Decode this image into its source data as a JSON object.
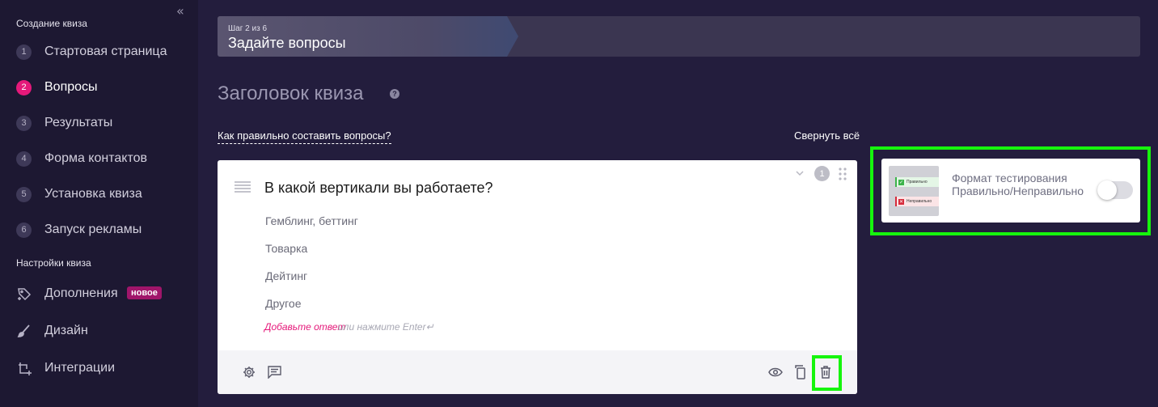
{
  "sidebar": {
    "collapse_glyph": "«",
    "section_create": "Создание квиза",
    "steps": [
      {
        "num": "1",
        "label": "Стартовая страница"
      },
      {
        "num": "2",
        "label": "Вопросы"
      },
      {
        "num": "3",
        "label": "Результаты"
      },
      {
        "num": "4",
        "label": "Форма контактов"
      },
      {
        "num": "5",
        "label": "Установка квиза"
      },
      {
        "num": "6",
        "label": "Запуск рекламы"
      }
    ],
    "section_settings": "Настройки квиза",
    "settings_items": [
      {
        "label": "Дополнения",
        "icon": "tag-plus-icon",
        "badge": "новое"
      },
      {
        "label": "Дизайн",
        "icon": "brush-icon"
      },
      {
        "label": "Интеграции",
        "icon": "integrations-icon"
      }
    ]
  },
  "stepper": {
    "counter": "Шаг 2 из 6",
    "title": "Задайте вопросы"
  },
  "main": {
    "quiz_title": "Заголовок квиза",
    "help_glyph": "?",
    "howto_link": "Как правильно составить вопросы?",
    "collapse_all": "Свернуть всё"
  },
  "question": {
    "number": "1",
    "text": "В какой вертикали вы работаете?",
    "answers": [
      "Гемблинг, беттинг",
      "Товарка",
      "Дейтинг",
      "Другое"
    ],
    "add_answer": "Добавьте ответ",
    "add_hint": "или нажмите Enter↵",
    "footer_icons": [
      "settings-icon",
      "comment-icon",
      "preview-eye-icon",
      "copy-icon",
      "trash-icon"
    ]
  },
  "test_format": {
    "label": "Формат тестирования Правильно/Неправильно",
    "enabled": false,
    "thumb_correct": "Правильно",
    "thumb_wrong": "Неправильно"
  },
  "colors": {
    "accent": "#e5197a",
    "highlight": "#16f50d",
    "background": "#231d3d",
    "sidebar": "#1d1832"
  }
}
